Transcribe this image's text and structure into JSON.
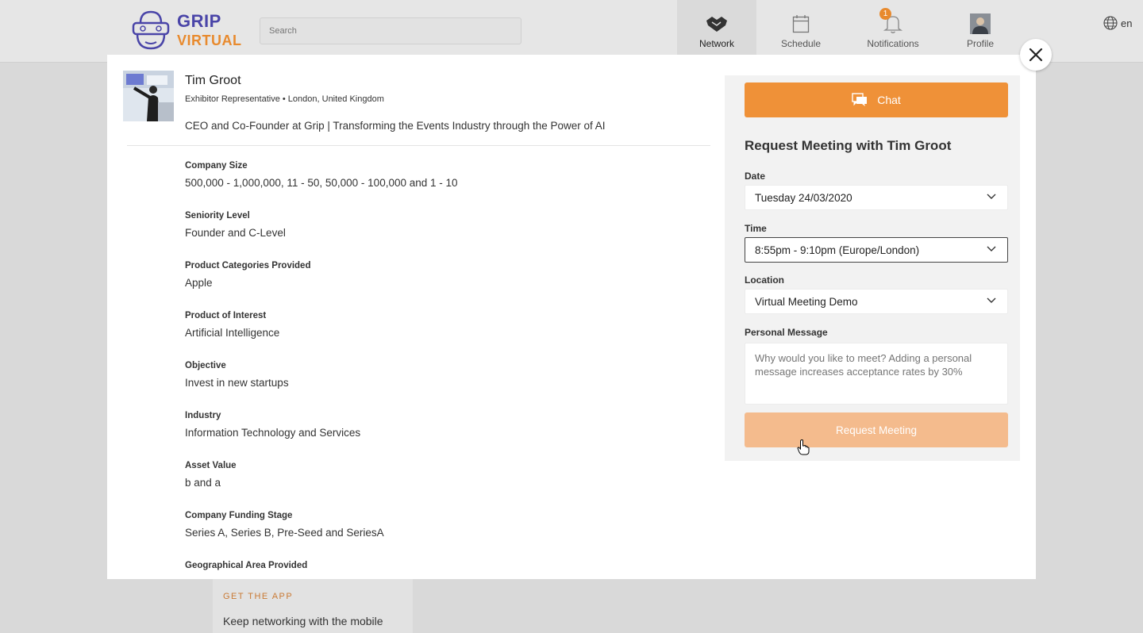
{
  "brand": {
    "line1": "GRIP",
    "line2": "VIRTUAL"
  },
  "search": {
    "placeholder": "Search"
  },
  "nav": [
    {
      "label": "Network",
      "icon": "handshake-icon",
      "active": true
    },
    {
      "label": "Schedule",
      "icon": "calendar-icon"
    },
    {
      "label": "Notifications",
      "icon": "bell-icon",
      "badge": "1"
    },
    {
      "label": "Profile",
      "icon": "profile-avatar"
    }
  ],
  "language": {
    "label": "en",
    "icon": "globe-icon"
  },
  "get_app": {
    "title": "GET THE APP",
    "text": "Keep networking with the mobile"
  },
  "profile": {
    "name": "Tim Groot",
    "meta": "Exhibitor Representative • London, United Kingdom",
    "headline": "CEO and Co-Founder at Grip | Transforming the Events Industry through the Power of AI",
    "fields": [
      {
        "label": "Company Size",
        "value": "500,000 - 1,000,000, 11 - 50, 50,000 - 100,000 and 1 - 10"
      },
      {
        "label": "Seniority Level",
        "value": "Founder and C-Level"
      },
      {
        "label": "Product Categories Provided",
        "value": "Apple"
      },
      {
        "label": "Product of Interest",
        "value": "Artificial Intelligence"
      },
      {
        "label": "Objective",
        "value": "Invest in new startups"
      },
      {
        "label": "Industry",
        "value": "Information Technology and Services"
      },
      {
        "label": "Asset Value",
        "value": "b and a"
      },
      {
        "label": "Company Funding Stage",
        "value": "Series A, Series B, Pre-Seed and SeriesA"
      },
      {
        "label": "Geographical Area Provided",
        "value": ""
      }
    ]
  },
  "meeting": {
    "chat_label": "Chat",
    "title": "Request Meeting with Tim Groot",
    "date_label": "Date",
    "date_value": "Tuesday 24/03/2020",
    "time_label": "Time",
    "time_value": "8:55pm - 9:10pm (Europe/London)",
    "location_label": "Location",
    "location_value": "Virtual Meeting Demo",
    "message_label": "Personal Message",
    "message_placeholder": "Why would you like to meet? Adding a personal message increases acceptance rates by 30%",
    "submit_label": "Request Meeting"
  },
  "colors": {
    "accent": "#ef9138",
    "brand": "#4a45a8",
    "disabled_accent": "#f4bb8d"
  }
}
